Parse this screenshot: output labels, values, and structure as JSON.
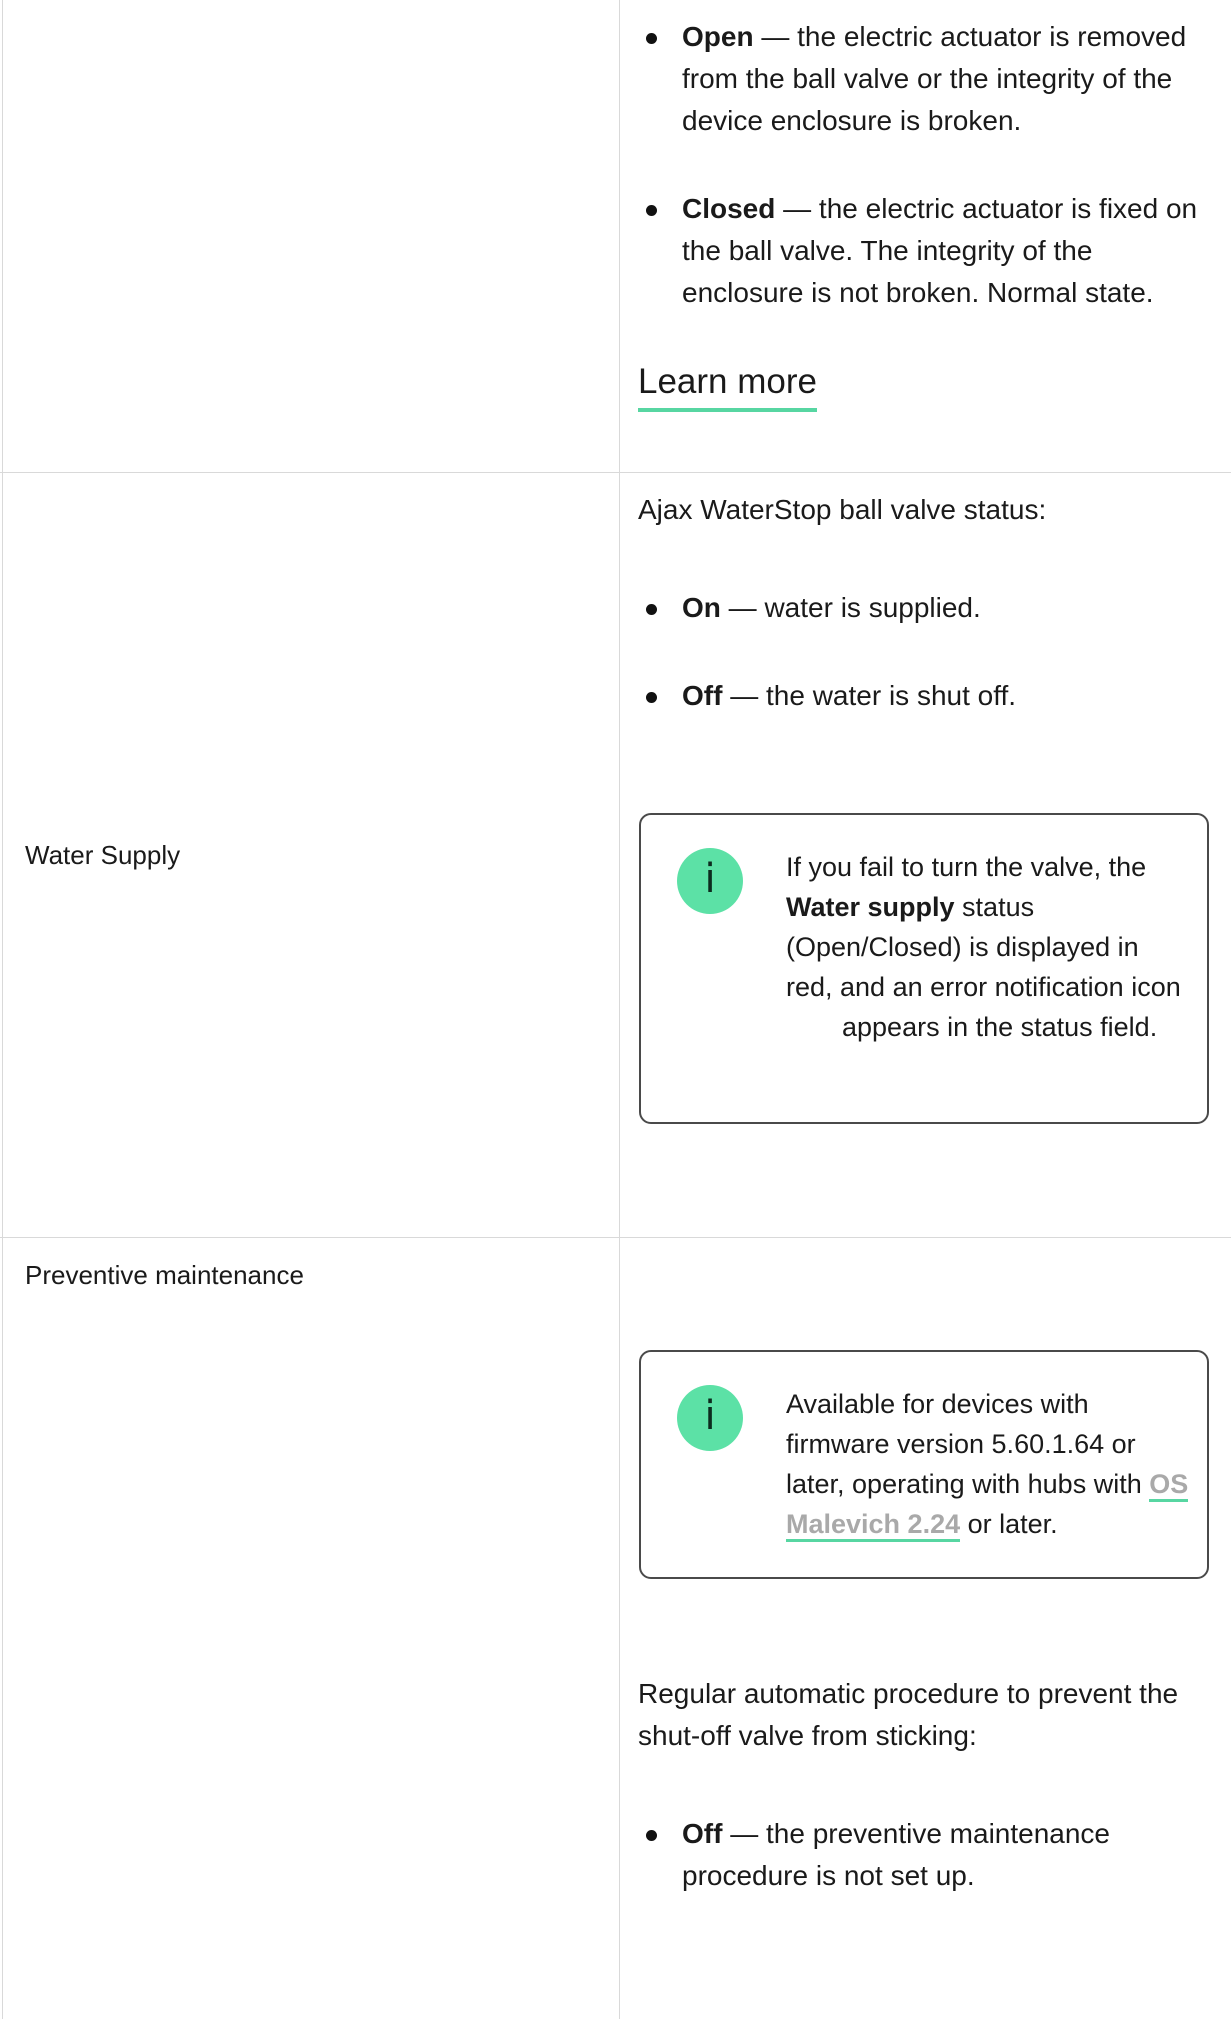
{
  "tamper_cell": {
    "items": [
      {
        "term": "Open",
        "desc": "— the electric actuator is removed from the ball valve or the integrity of the device enclosure is broken."
      },
      {
        "term": "Closed",
        "desc": "— the electric actuator is fixed on the ball valve. The integrity of the enclosure is not broken. Normal state."
      }
    ],
    "learn_more": "Learn more"
  },
  "water_supply": {
    "label": "Water Supply",
    "intro": "Ajax WaterStop ball valve status:",
    "items": [
      {
        "term": "On",
        "desc": "— water is supplied."
      },
      {
        "term": "Off",
        "desc": "— the water is shut off."
      }
    ],
    "note": {
      "icon": "info-icon",
      "glyph": "i",
      "text_before": "If you fail to turn the valve, the",
      "bold": "Water supply",
      "text_after": "status (Open/Closed) is displayed in red, and an error notification icon",
      "text_end": "appears in the status field."
    }
  },
  "preventive_maintenance": {
    "label": "Preventive maintenance",
    "note": {
      "icon": "info-icon",
      "glyph": "i",
      "text_before": "Available for devices with firmware version 5.60.1.64 or later, operating with hubs with",
      "link": "OS Malevich 2.24",
      "text_after": "or later."
    },
    "intro": "Regular automatic procedure to prevent the shut-off valve from sticking:",
    "items": [
      {
        "term": "Off",
        "desc": "— the preventive maintenance procedure is not set up."
      }
    ]
  },
  "colors": {
    "accent": "#57d6a2",
    "icon_bg": "#5ce1a6",
    "border": "#d9d9d9"
  }
}
